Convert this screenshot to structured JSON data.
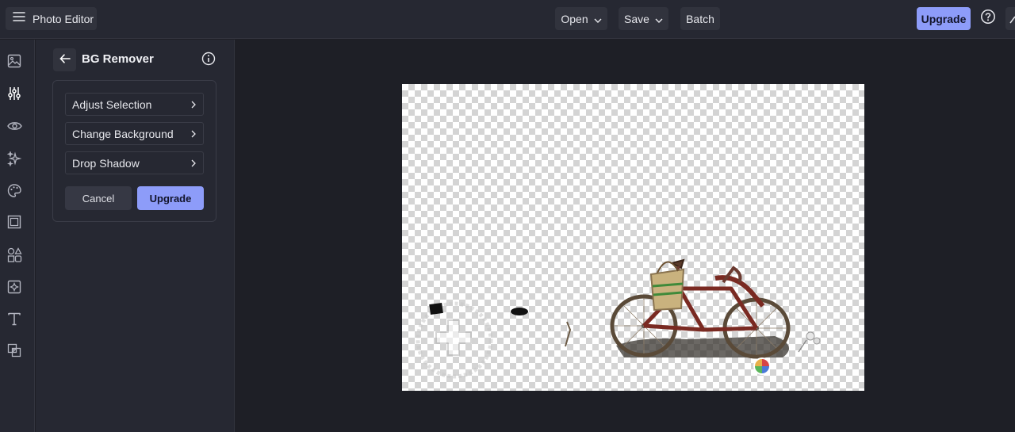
{
  "topbar": {
    "app_title": "Photo Editor",
    "open_label": "Open",
    "save_label": "Save",
    "batch_label": "Batch",
    "upgrade_label": "Upgrade"
  },
  "rail": {
    "icons": [
      "image-icon",
      "sliders-icon",
      "eye-icon",
      "sparkles-icon",
      "palette-icon",
      "frame-icon",
      "shapes-icon",
      "texture-icon",
      "text-icon",
      "layers-icon"
    ]
  },
  "panel": {
    "title": "BG Remover",
    "options": [
      {
        "label": "Adjust Selection"
      },
      {
        "label": "Change Background"
      },
      {
        "label": "Drop Shadow"
      }
    ],
    "cancel_label": "Cancel",
    "upgrade_label": "Upgrade"
  },
  "canvas": {
    "subject": "bicycle-with-basket",
    "background": "transparent-checkerboard"
  },
  "colors": {
    "accent": "#8d9cf9",
    "topbar_bg": "#262832",
    "workspace_bg": "#1e1f26"
  }
}
